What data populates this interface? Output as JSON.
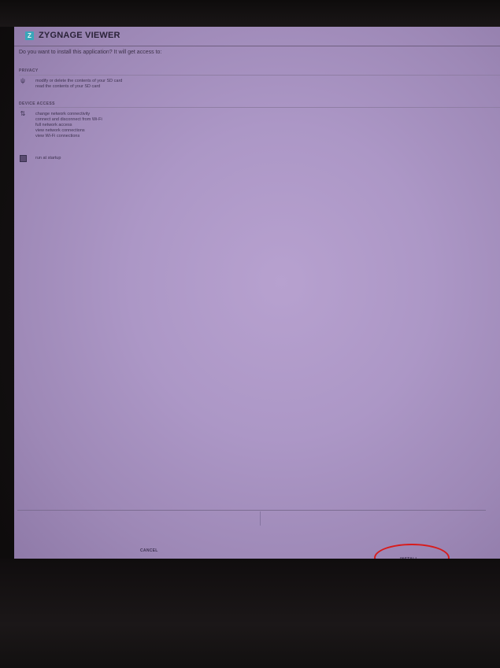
{
  "app": {
    "icon_glyph": "Z",
    "title": "ZYGNAGE VIEWER"
  },
  "prompt": "Do you want to install this application? It will get access to:",
  "sections": {
    "privacy": {
      "header": "PRIVACY",
      "icon": "usb-icon",
      "items": [
        "modify or delete the contents of your SD card",
        "read the contents of your SD card"
      ]
    },
    "device_access": {
      "header": "DEVICE ACCESS",
      "icon": "network-icon",
      "items": [
        "change network connectivity",
        "connect and disconnect from Wi-Fi",
        "full network access",
        "view network connections",
        "view Wi-Fi connections"
      ],
      "extra": {
        "icon": "box-icon",
        "label": "run at startup"
      }
    }
  },
  "buttons": {
    "cancel": "CANCEL",
    "install": "INSTALL"
  },
  "colors": {
    "screen": "#ac97c6",
    "icon_accent": "#3aa6b9",
    "annotation": "#d81b1b"
  }
}
